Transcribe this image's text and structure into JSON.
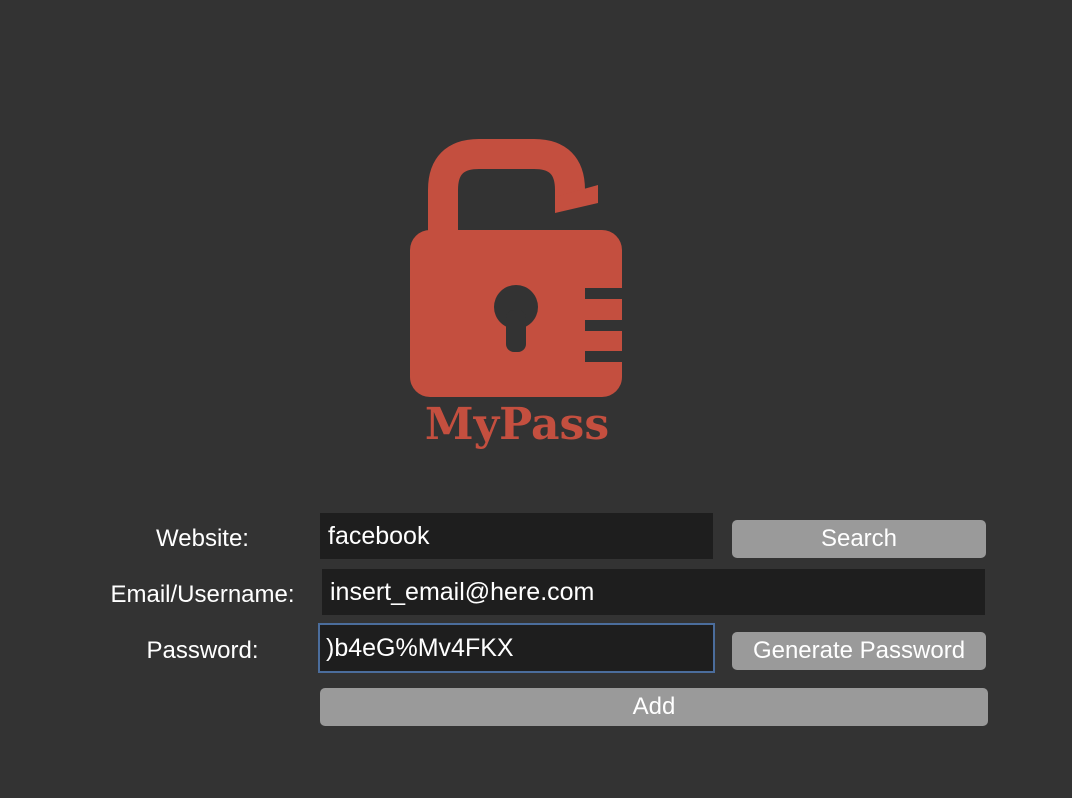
{
  "logo": {
    "icon": "open-padlock-icon",
    "text": "MyPass",
    "color": "#c44f3f"
  },
  "form": {
    "website_label": "Website:",
    "website_value": "facebook",
    "email_label": "Email/Username:",
    "email_value": "insert_email@here.com",
    "password_label": "Password:",
    "password_value": ")b4eG%Mv4FKX"
  },
  "buttons": {
    "search_label": "Search",
    "generate_label": "Generate Password",
    "add_label": "Add"
  },
  "colors": {
    "background": "#333333",
    "field_background": "#1e1e1e",
    "button_background": "#9a9a9a",
    "focus_ring": "#4b6d9c",
    "brand": "#c44f3f"
  }
}
